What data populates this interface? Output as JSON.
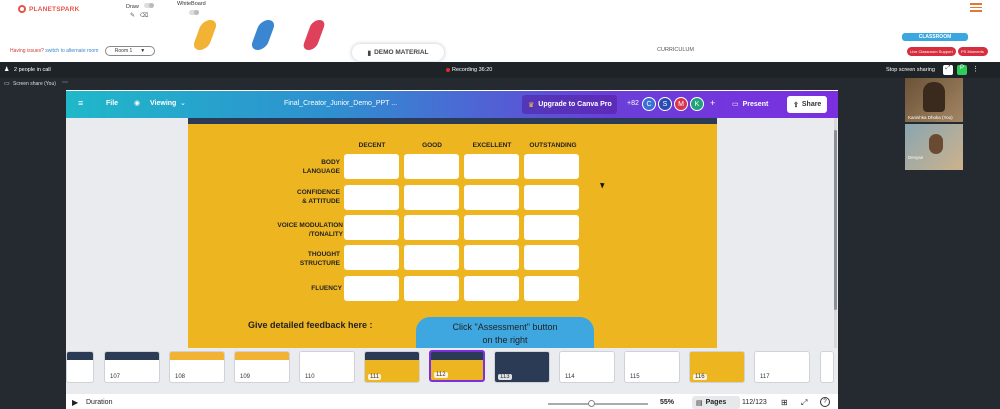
{
  "app": {
    "logo_text": "PLANETSPARK",
    "draw_label": "Draw",
    "whiteboard_label": "WhiteBoard",
    "issue_text": "Having issues?",
    "issue_link": "switch to alternate room",
    "room_label": "Room 1",
    "demo_material_label": "DEMO MATERIAL",
    "curriculum_label": "CURRICULUM",
    "classroom_label": "CLASSROOM",
    "live_support_label": "Live Classroom Support",
    "pi_moments_label": "PS Moments"
  },
  "call": {
    "people_text": "2 people in call",
    "recording_text": "Recording 36:20",
    "stop_share_label": "Stop screen sharing",
    "screen_share_label": "Screen share (You)",
    "participants": [
      {
        "name": "Kanishka Dhoka (You)"
      },
      {
        "name": "Devyan"
      }
    ]
  },
  "canva": {
    "file_label": "File",
    "viewing_label": "Viewing",
    "doc_title": "Final_Creator_Junior_Demo_PPT ...",
    "upgrade_label": "Upgrade to Canva Pro",
    "collab_count": "+82",
    "avatars": [
      "C",
      "S",
      "M",
      "K"
    ],
    "avatar_colors": [
      "#3b6fd8",
      "#2a4bb0",
      "#d8344e",
      "#20a37a"
    ],
    "plus_label": "+",
    "present_label": "Present",
    "share_label": "Share"
  },
  "slide": {
    "columns": [
      "DECENT",
      "GOOD",
      "EXCELLENT",
      "OUTSTANDING"
    ],
    "rows": [
      [
        "BODY",
        "LANGUAGE"
      ],
      [
        "CONFIDENCE",
        "& ATTITUDE"
      ],
      [
        "VOICE MODULATION",
        "/TONALITY"
      ],
      [
        "THOUGHT",
        "STRUCTURE"
      ],
      [
        "FLUENCY"
      ]
    ],
    "feedback_label": "Give detailed feedback here :",
    "assessment_line1": "Click \"Assessment\" button",
    "assessment_line2": "on the right"
  },
  "thumbnails": [
    {
      "num": "107"
    },
    {
      "num": "108"
    },
    {
      "num": "109"
    },
    {
      "num": "110"
    },
    {
      "num": "111"
    },
    {
      "num": "112"
    },
    {
      "num": "113"
    },
    {
      "num": "114"
    },
    {
      "num": "115"
    },
    {
      "num": "116"
    },
    {
      "num": "117"
    }
  ],
  "bottom": {
    "duration_label": "Duration",
    "zoom_value": "55%",
    "pages_label": "Pages",
    "page_counter": "112/123"
  }
}
